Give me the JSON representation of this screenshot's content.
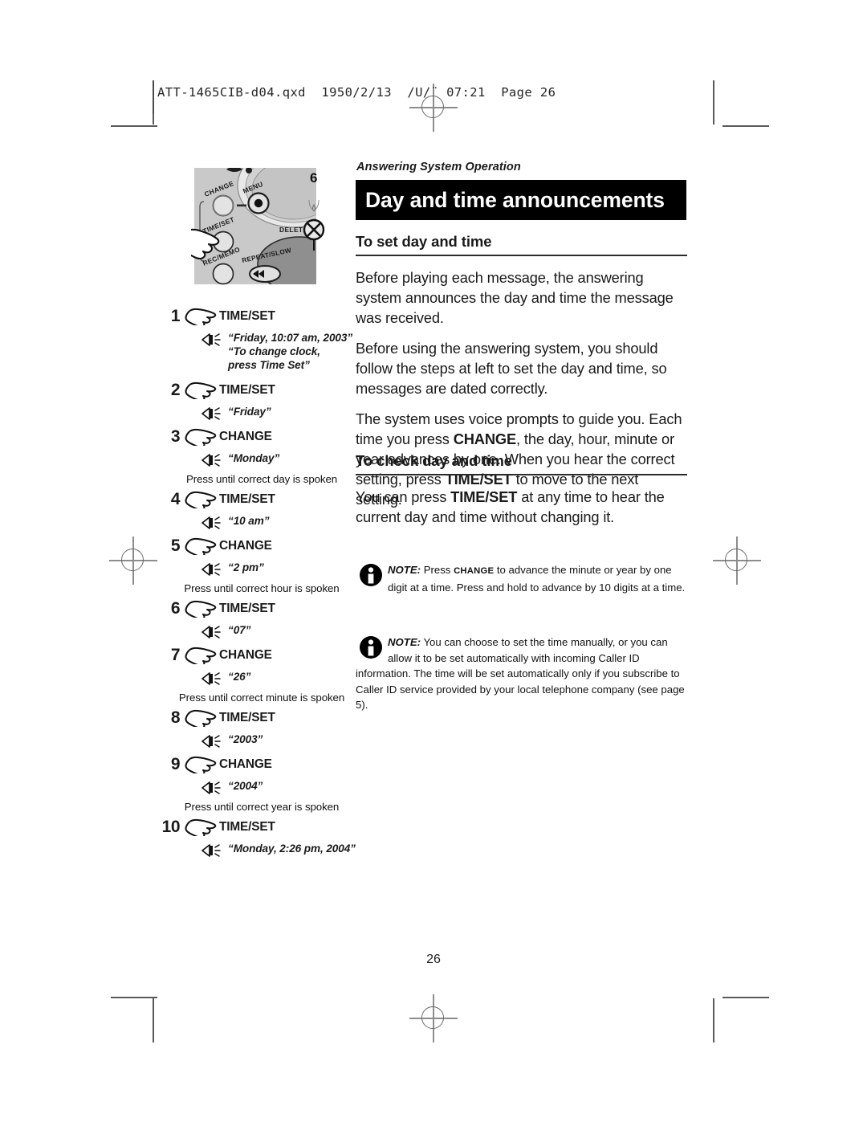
{
  "prepress": {
    "file_slug": "ATT-1465CIB-d04.qxd  1950/2/13  ∕U∕¨ 07:21  Page 26"
  },
  "running_head": "Answering System Operation",
  "banner": {
    "title": "Day and time announcements"
  },
  "sections": [
    {
      "heading": "To set day and time",
      "paragraphs": [
        "Before playing each message, the answering system announces the day and time the message was received.",
        "Before using the answering system, you should follow the steps at left to set the day and time, so messages are dated correctly."
      ]
    },
    {
      "heading": "To check day and time",
      "paragraphs": [
        "You can press TIME/SET at any time to hear the current day and time without changing it."
      ]
    }
  ],
  "paragraph_voice_prompts": {
    "lead": "The system uses voice prompts to guide you. Each time you press ",
    "kw1": "CHANGE",
    "mid": ", the day, hour, minute or year advances by one. When you hear the correct setting, press ",
    "kw2": "TIME/SET",
    "tail": " to move to the next setting."
  },
  "paragraph_check": {
    "lead": "You can press ",
    "kw1": "TIME/SET",
    "tail": " at any time to hear the current day and time without changing it."
  },
  "notes": [
    {
      "label": "NOTE:",
      "lead": " Press ",
      "keyword": "CHANGE",
      "body": " to advance the minute or year by one digit at a time. Press and hold to advance by 10 digits at a time."
    },
    {
      "label": "NOTE:",
      "lead": "",
      "keyword": "",
      "body": " You can choose to set the time manually, or you can allow it to be set automatically with incoming Caller ID information. The time will be set automatically only if you subscribe to Caller ID service provided by your local telephone company (see page 5)."
    }
  ],
  "steps": [
    {
      "num": "1",
      "key": "TIME/SET",
      "speech": "“Friday, 10:07 am, 2003”",
      "speech2_l1": "“To change clock,",
      "speech2_l2": "press Time Set”",
      "hint": ""
    },
    {
      "num": "2",
      "key": "TIME/SET",
      "speech": "“Friday”",
      "hint": ""
    },
    {
      "num": "3",
      "key": "CHANGE",
      "speech": "“Monday”",
      "hint": "Press until correct day is spoken"
    },
    {
      "num": "4",
      "key": "TIME/SET",
      "speech": "“10 am”",
      "hint": ""
    },
    {
      "num": "5",
      "key": "CHANGE",
      "speech": "“2 pm”",
      "hint": "Press until correct hour is spoken"
    },
    {
      "num": "6",
      "key": "TIME/SET",
      "speech": "“07”",
      "hint": ""
    },
    {
      "num": "7",
      "key": "CHANGE",
      "speech": "“26”",
      "hint": "Press until correct minute is spoken"
    },
    {
      "num": "8",
      "key": "TIME/SET",
      "speech": "“2003”",
      "hint": ""
    },
    {
      "num": "9",
      "key": "CHANGE",
      "speech": "“2004”",
      "hint": "Press until correct year is spoken"
    },
    {
      "num": "10",
      "key": "TIME/SET",
      "speech": "“Monday, 2:26 pm, 2004”",
      "hint": ""
    }
  ],
  "illustration": {
    "callout_number": "6",
    "button_labels": {
      "change": "CHANGE",
      "menu": "MENU",
      "time_set": "TIME/SET",
      "rec_memo": "REC/MEMO",
      "repeat_slow": "REPEAT/SLOW",
      "delete": "DELETE"
    }
  },
  "folio": "26"
}
